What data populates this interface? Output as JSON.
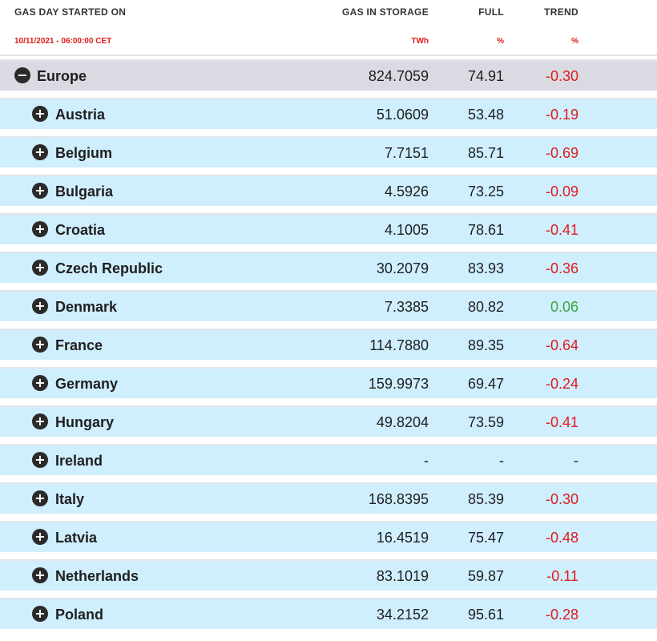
{
  "header": {
    "col1": "GAS DAY STARTED ON",
    "col2": "GAS IN STORAGE",
    "col3": "FULL",
    "col4": "TREND",
    "date": "10/11/2021 - 06:00:00 CET",
    "unit2": "TWh",
    "unit3": "%",
    "unit4": "%"
  },
  "rows": [
    {
      "name": "Europe",
      "storage": "824.7059",
      "full": "74.91",
      "trend": "-0.30",
      "level": "region",
      "icon": "minus-circle-icon"
    },
    {
      "name": "Austria",
      "storage": "51.0609",
      "full": "53.48",
      "trend": "-0.19",
      "level": "country",
      "icon": "plus-circle-icon"
    },
    {
      "name": "Belgium",
      "storage": "7.7151",
      "full": "85.71",
      "trend": "-0.69",
      "level": "country",
      "icon": "plus-circle-icon"
    },
    {
      "name": "Bulgaria",
      "storage": "4.5926",
      "full": "73.25",
      "trend": "-0.09",
      "level": "country",
      "icon": "plus-circle-icon"
    },
    {
      "name": "Croatia",
      "storage": "4.1005",
      "full": "78.61",
      "trend": "-0.41",
      "level": "country",
      "icon": "plus-circle-icon"
    },
    {
      "name": "Czech Republic",
      "storage": "30.2079",
      "full": "83.93",
      "trend": "-0.36",
      "level": "country",
      "icon": "plus-circle-icon"
    },
    {
      "name": "Denmark",
      "storage": "7.3385",
      "full": "80.82",
      "trend": "0.06",
      "level": "country",
      "icon": "plus-circle-icon"
    },
    {
      "name": "France",
      "storage": "114.7880",
      "full": "89.35",
      "trend": "-0.64",
      "level": "country",
      "icon": "plus-circle-icon"
    },
    {
      "name": "Germany",
      "storage": "159.9973",
      "full": "69.47",
      "trend": "-0.24",
      "level": "country",
      "icon": "plus-circle-icon"
    },
    {
      "name": "Hungary",
      "storage": "49.8204",
      "full": "73.59",
      "trend": "-0.41",
      "level": "country",
      "icon": "plus-circle-icon"
    },
    {
      "name": "Ireland",
      "storage": "-",
      "full": "-",
      "trend": "-",
      "level": "country",
      "icon": "plus-circle-icon"
    },
    {
      "name": "Italy",
      "storage": "168.8395",
      "full": "85.39",
      "trend": "-0.30",
      "level": "country",
      "icon": "plus-circle-icon"
    },
    {
      "name": "Latvia",
      "storage": "16.4519",
      "full": "75.47",
      "trend": "-0.48",
      "level": "country",
      "icon": "plus-circle-icon"
    },
    {
      "name": "Netherlands",
      "storage": "83.1019",
      "full": "59.87",
      "trend": "-0.11",
      "level": "country",
      "icon": "plus-circle-icon"
    },
    {
      "name": "Poland",
      "storage": "34.2152",
      "full": "95.61",
      "trend": "-0.28",
      "level": "country",
      "icon": "plus-circle-icon"
    }
  ],
  "colors": {
    "trend_negative": "#e01b1b",
    "trend_positive": "#3aa63a",
    "region_row_bg": "#dadbe2",
    "country_row_bg": "#cfeefe",
    "header_sub": "#e11b1b"
  }
}
